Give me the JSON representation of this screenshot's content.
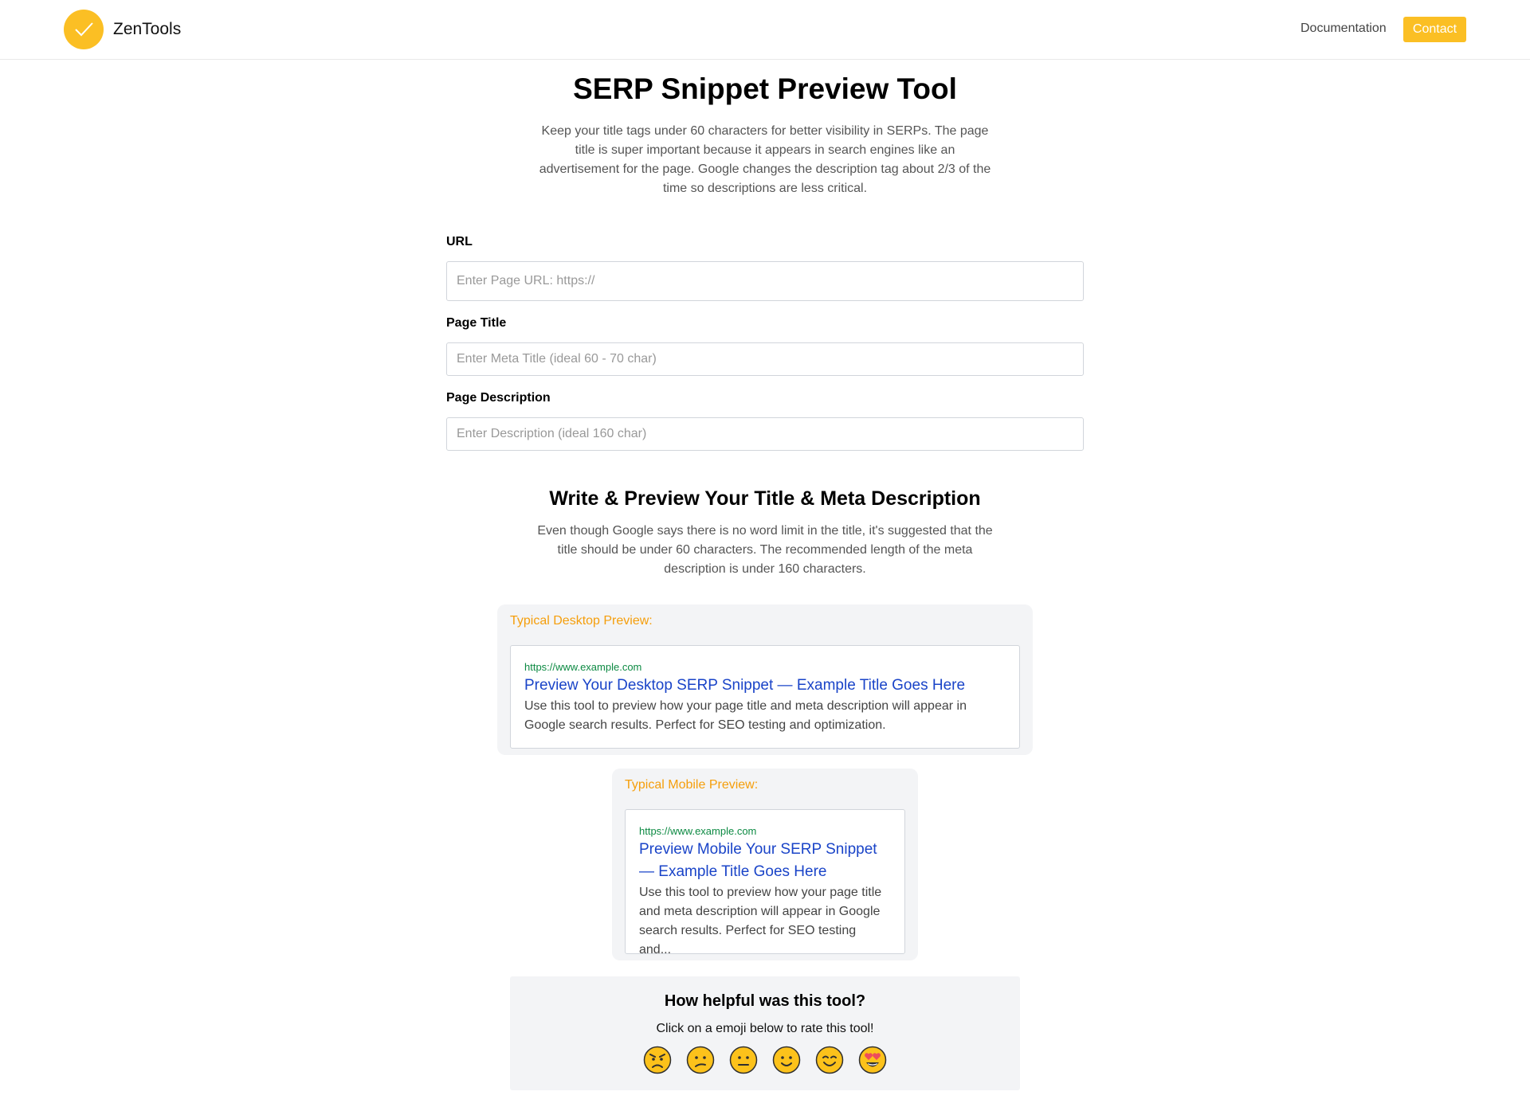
{
  "header": {
    "brand": "ZenTools",
    "nav_documentation": "Documentation",
    "nav_contact": "Contact"
  },
  "hero": {
    "title": "SERP Snippet Preview Tool",
    "description": "Keep your title tags under 60 characters for better visibility in SERPs. The page title is super important because it appears in search engines like an advertisement for the page. Google changes the description tag about 2/3 of the time so descriptions are less critical."
  },
  "form": {
    "url_label": "URL",
    "url_placeholder": "Enter Page URL: https://",
    "title_label": "Page Title",
    "title_placeholder": "Enter Meta Title (ideal 60 - 70 char)",
    "desc_label": "Page Description",
    "desc_placeholder": "Enter Description (ideal 160 char)"
  },
  "section": {
    "title": "Write & Preview Your Title & Meta Description",
    "description": "Even though Google says there is no word limit in the title, it's suggested that the title should be under 60 characters. The recommended length of the meta description is under 160 characters."
  },
  "desktop_preview": {
    "label": "Typical Desktop Preview:",
    "url": "https://www.example.com",
    "title": "Preview Your Desktop SERP Snippet — Example Title Goes Here",
    "description": "Use this tool to preview how your page title and meta description will appear in Google search results. Perfect for SEO testing and optimization."
  },
  "mobile_preview": {
    "label": "Typical Mobile Preview:",
    "url": "https://www.example.com",
    "title": "Preview Mobile Your SERP Snippet — Example Title Goes Here",
    "description": "Use this tool to preview how your page title and meta description will appear in Google search results. Perfect for SEO testing and..."
  },
  "rating": {
    "title": "How helpful was this tool?",
    "subtitle": "Click on a emoji below to rate this tool!",
    "emojis": [
      "angry-face-icon",
      "confused-face-icon",
      "neutral-face-icon",
      "slightly-smiling-face-icon",
      "smiling-face-icon",
      "heart-eyes-face-icon"
    ]
  },
  "colors": {
    "accent": "#fbbf24",
    "preview_label": "#f59e0b",
    "serp_url": "#0d8a43",
    "serp_title": "#1a44c8"
  }
}
